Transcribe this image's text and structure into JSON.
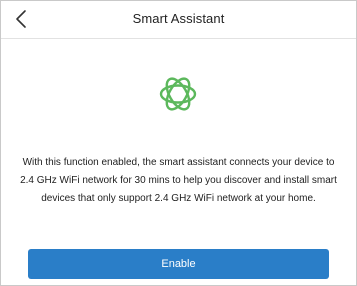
{
  "header": {
    "title": "Smart Assistant",
    "back_icon": "chevron-left-icon"
  },
  "main": {
    "logo_icon": "atom-orbit-icon",
    "logo_color": "#5cb85c",
    "description": "With this function enabled, the smart assistant connects your device to 2.4 GHz WiFi network for 30 mins to help you discover and install smart devices that only support 2.4 GHz WiFi network at your home."
  },
  "footer": {
    "enable_label": "Enable",
    "button_color": "#2a7ec8"
  }
}
